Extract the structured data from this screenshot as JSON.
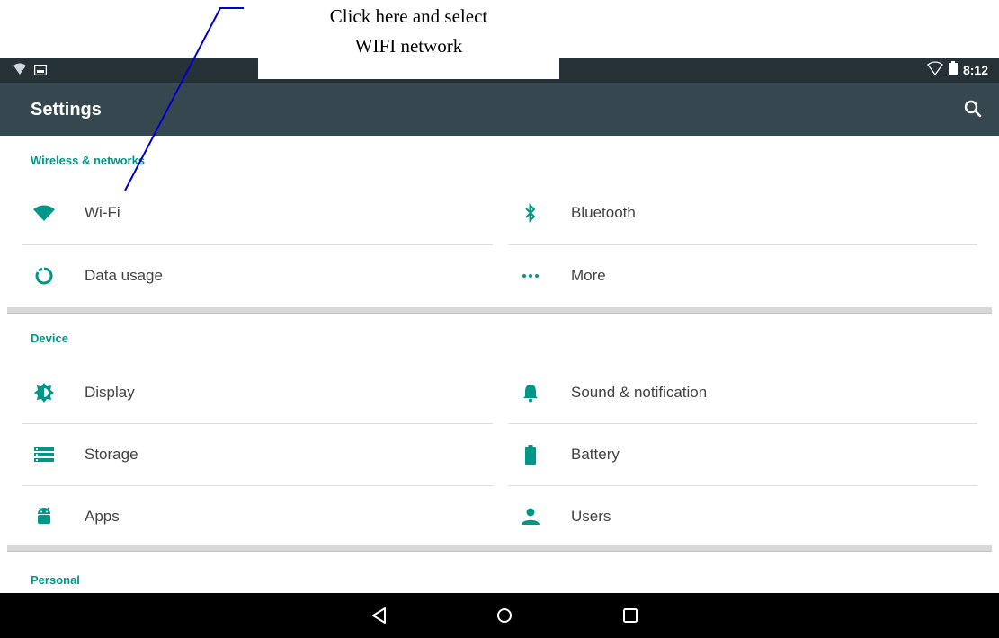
{
  "callout": {
    "line1": "Click here and select",
    "line2": "WIFI network"
  },
  "status_bar": {
    "time": "8:12",
    "icons_left": [
      "wifi-unknown-icon",
      "image-notification-icon"
    ],
    "icons_right": [
      "wifi-outline-icon",
      "battery-icon"
    ]
  },
  "app_bar": {
    "title": "Settings",
    "search_icon": "search-icon"
  },
  "colors": {
    "status_bar": "#263238",
    "app_bar": "#37474f",
    "accent": "#009688",
    "text": "#424242",
    "nav_bar": "#000000"
  },
  "sections": [
    {
      "header": "Wireless & networks",
      "items": [
        {
          "label": "Wi-Fi",
          "icon": "wifi-icon"
        },
        {
          "label": "Bluetooth",
          "icon": "bluetooth-icon"
        },
        {
          "label": "Data usage",
          "icon": "data-usage-icon"
        },
        {
          "label": "More",
          "icon": "more-dots-icon"
        }
      ]
    },
    {
      "header": "Device",
      "items": [
        {
          "label": "Display",
          "icon": "brightness-icon"
        },
        {
          "label": "Sound & notification",
          "icon": "bell-icon"
        },
        {
          "label": "Storage",
          "icon": "storage-icon"
        },
        {
          "label": "Battery",
          "icon": "battery-icon"
        },
        {
          "label": "Apps",
          "icon": "android-icon"
        },
        {
          "label": "Users",
          "icon": "person-icon"
        }
      ]
    },
    {
      "header": "Personal",
      "items": []
    }
  ],
  "nav_bar": {
    "buttons": [
      "back-icon",
      "home-icon",
      "recents-icon"
    ]
  }
}
